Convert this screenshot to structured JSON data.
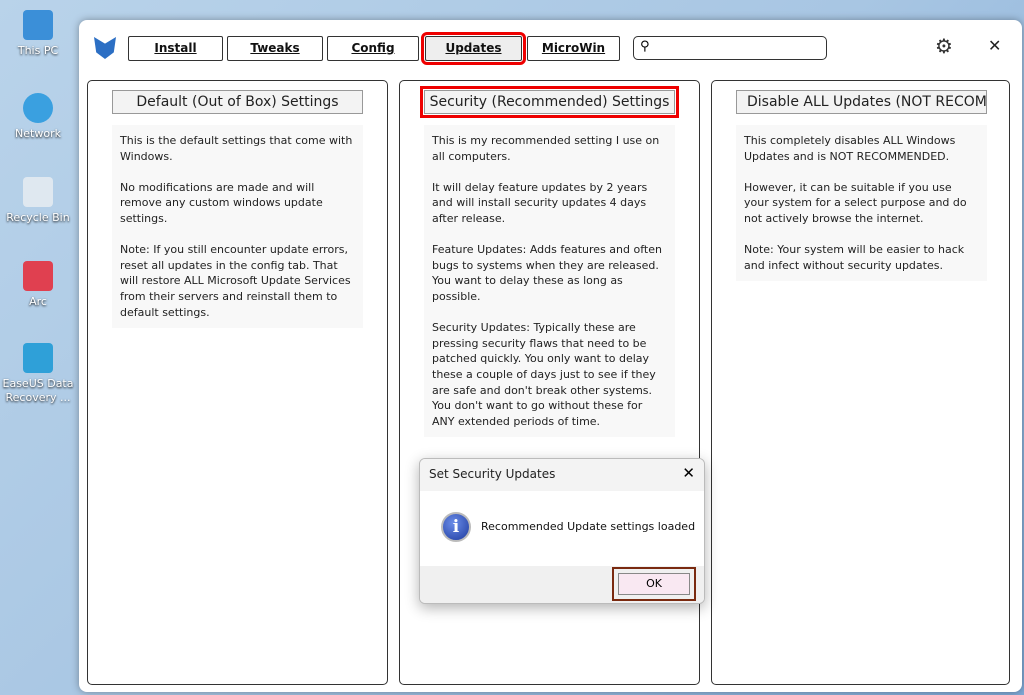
{
  "desktop": [
    {
      "label": "This PC",
      "color": "#3b8fd8"
    },
    {
      "label": "Network",
      "color": "#3aa0e0"
    },
    {
      "label": "Recycle Bin",
      "color": "#dfe8f0"
    },
    {
      "label": "Arc",
      "color": "#e04050"
    },
    {
      "label": "EaseUS Data Recovery ...",
      "color": "#2fa0d8"
    }
  ],
  "tabs": [
    "Install",
    "Tweaks",
    "Config",
    "Updates",
    "MicroWin"
  ],
  "search": {
    "icon": "⚲",
    "value": ""
  },
  "icons": {
    "gear": "⚙",
    "close": "✕"
  },
  "panels": [
    {
      "title": "Default (Out of Box) Settings",
      "body": "This is the default settings that come with Windows.\n\nNo modifications are made and will remove any custom windows update settings.\n\nNote: If you still encounter update errors, reset all updates in the config tab. That will restore ALL Microsoft Update Services from their servers and reinstall them to default settings."
    },
    {
      "title": "Security (Recommended) Settings",
      "body": "This is my recommended setting I use on all computers.\n\nIt will delay feature updates by 2 years and will install security updates 4 days after release.\n\nFeature Updates: Adds features and often bugs to systems when they are released. You want to delay these as long as possible.\n\nSecurity Updates: Typically these are pressing security flaws that need to be patched quickly. You only want to delay these a couple of days just to see if they are safe and don't break other systems. You don't want to go without these for ANY extended periods of time."
    },
    {
      "title": "Disable ALL Updates (NOT RECOMMENDED!)",
      "body": "This completely disables ALL Windows Updates and is NOT RECOMMENDED.\n\nHowever, it can be suitable if you use your system for a select purpose and do not actively browse the internet.\n\nNote: Your system will be easier to hack and infect without security updates."
    }
  ],
  "dialog": {
    "title": "Set Security Updates",
    "close": "✕",
    "icon": "i",
    "message": "Recommended Update settings loaded",
    "ok": "OK"
  }
}
